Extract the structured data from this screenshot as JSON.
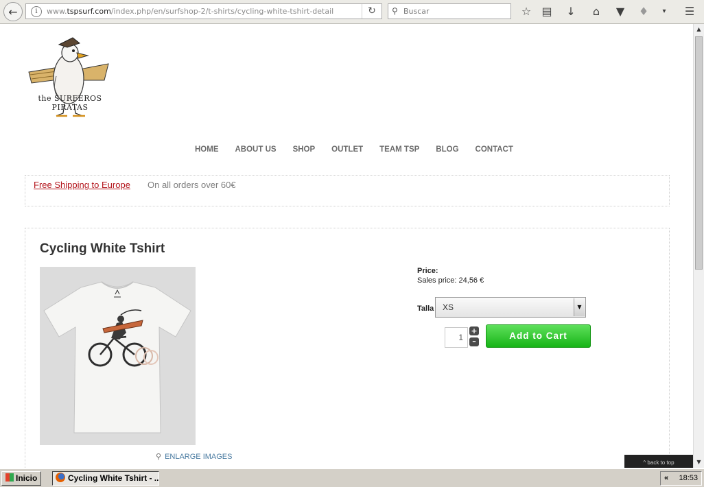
{
  "browser": {
    "url_prefix": "www.",
    "url_domain": "tspsurf.com",
    "url_path": "/index.php/en/surfshop-2/t-shirts/cycling-white-tshirt-detail",
    "search_placeholder": "Buscar"
  },
  "logo": {
    "text": "the SURFEROS PIRATAS"
  },
  "nav": [
    "HOME",
    "ABOUT US",
    "SHOP",
    "OUTLET",
    "TEAM TSP",
    "BLOG",
    "CONTACT"
  ],
  "shipping": {
    "link": "Free Shipping to Europe",
    "note": "On all orders over 60€"
  },
  "product": {
    "title": "Cycling White Tshirt",
    "enlarge_label": "ENLARGE IMAGES",
    "price_label": "Price:",
    "sales_price": "Sales price: 24,56 €",
    "size_label": "Talla",
    "size_value": "XS",
    "quantity": "1",
    "add_to_cart": "Add to Cart"
  },
  "back_to_top": "^ back to top",
  "taskbar": {
    "start": "Inicio",
    "window_title": "Cycling White Tshirt - ...",
    "tray_arrow": "«",
    "clock": "18:53"
  }
}
